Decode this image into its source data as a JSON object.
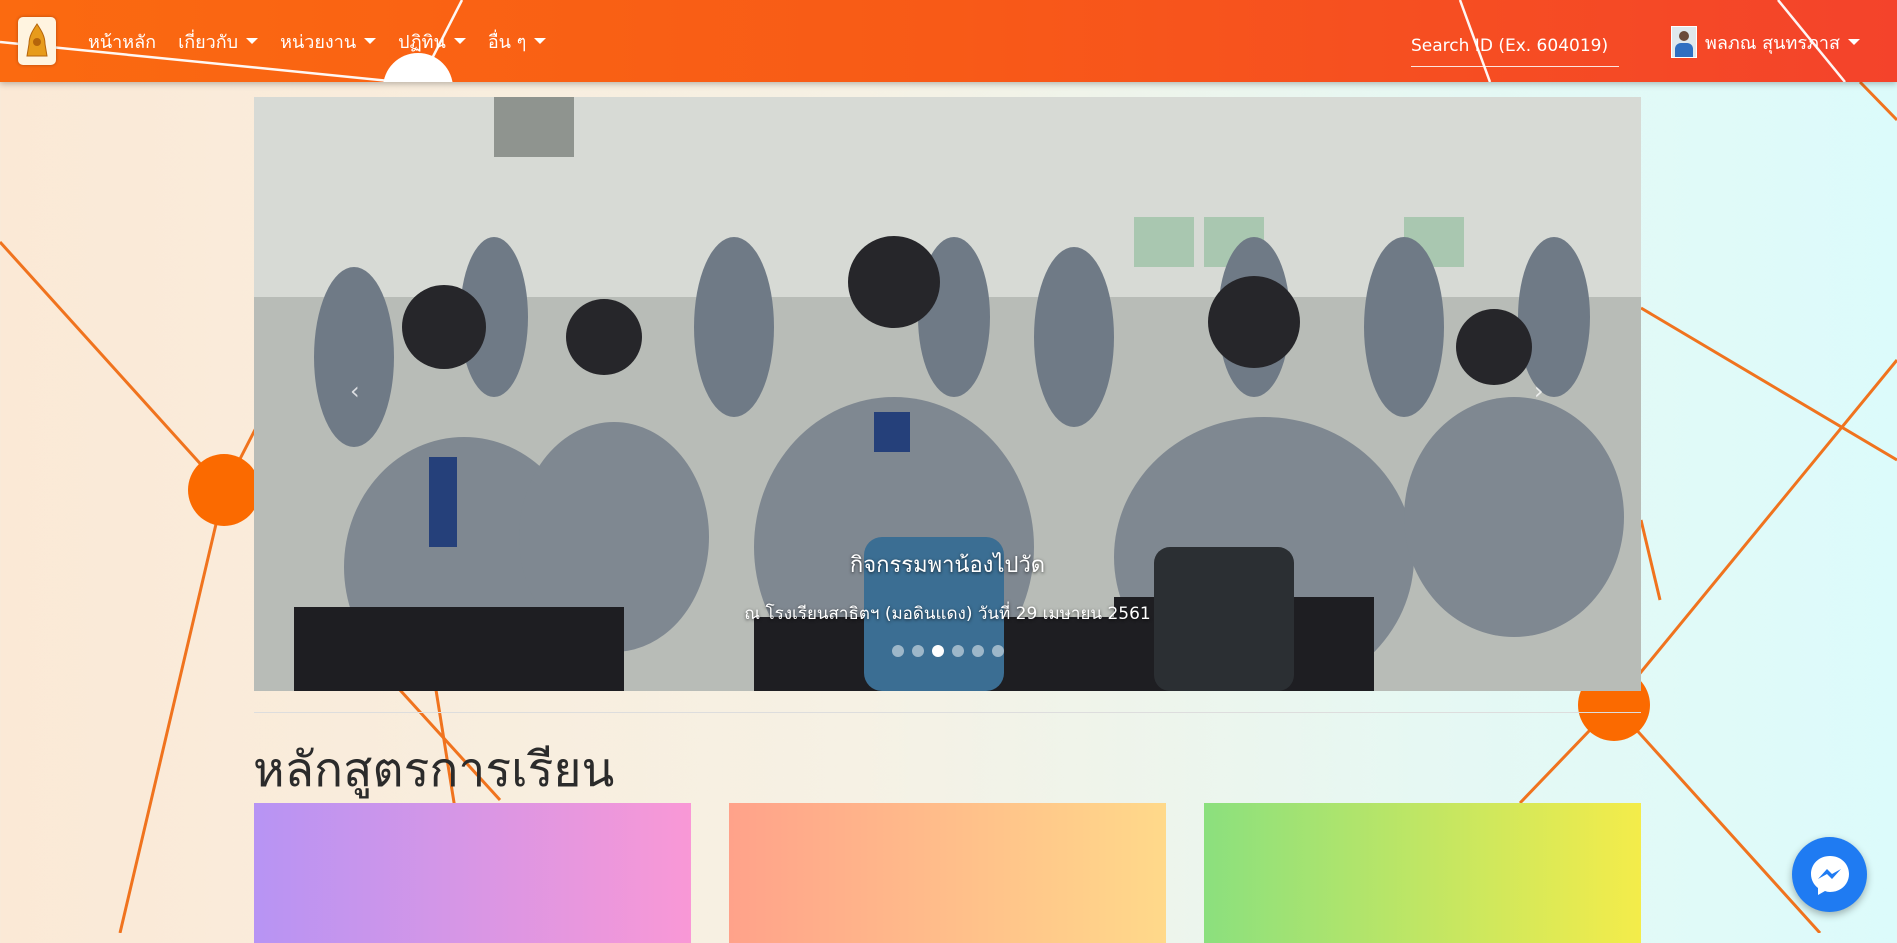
{
  "nav": {
    "logo_icon": "school-emblem-icon",
    "items": [
      {
        "label": "หน้าหลัก",
        "dropdown": false
      },
      {
        "label": "เกี่ยวกับ",
        "dropdown": true
      },
      {
        "label": "หน่วยงาน",
        "dropdown": true
      },
      {
        "label": "ปฏิทิน",
        "dropdown": true
      },
      {
        "label": "อื่น ๆ",
        "dropdown": true
      }
    ],
    "search": {
      "placeholder": "Search ID (Ex. 604019)",
      "value": ""
    },
    "user": {
      "name": "พลภณ สุนทรภาส",
      "avatar_icon": "user-avatar"
    }
  },
  "carousel": {
    "slide_title": "กิจกรรมพาน้องไปวัด",
    "slide_subtitle": "ณ โรงเรียนสาธิตฯ (มอดินแดง) วันที่ 29 เมษายน 2561",
    "prev_label": "‹",
    "next_label": "›",
    "slide_count": 6,
    "active_index": 2
  },
  "section": {
    "title": "หลักสูตรการเรียน"
  },
  "colors": {
    "nav_start": "#fb6a10",
    "nav_end": "#f4432b",
    "accent_lines": "#f26d1b",
    "messenger": "#1f7bf2"
  },
  "fab": {
    "icon": "messenger-icon"
  }
}
